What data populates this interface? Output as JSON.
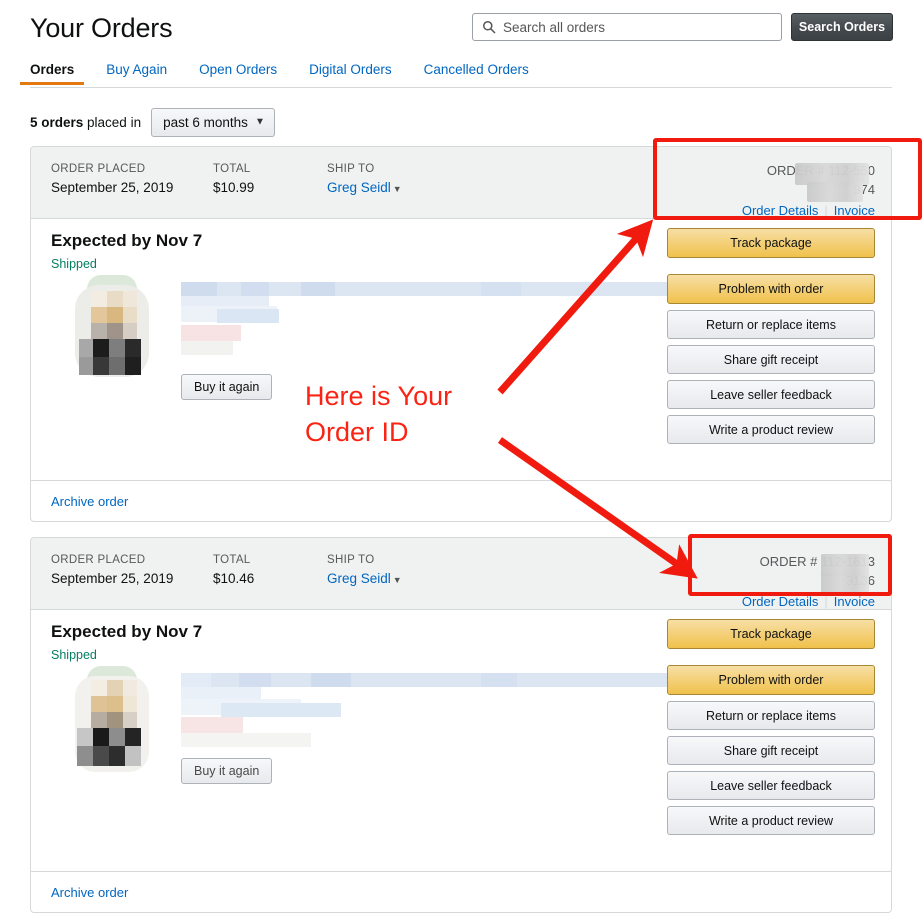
{
  "header": {
    "title": "Your Orders",
    "search": {
      "placeholder": "Search all orders",
      "value": "",
      "icon": "search-icon"
    },
    "search_button": "Search Orders"
  },
  "tabs": [
    {
      "label": "Orders",
      "active": true
    },
    {
      "label": "Buy Again",
      "active": false
    },
    {
      "label": "Open Orders",
      "active": false
    },
    {
      "label": "Digital Orders",
      "active": false
    },
    {
      "label": "Cancelled Orders",
      "active": false
    }
  ],
  "filter": {
    "count_bold": "5 orders",
    "count_rest": " placed in",
    "period_selected": "past 6 months",
    "chevron": "⌵"
  },
  "labels": {
    "order_placed": "ORDER PLACED",
    "total": "TOTAL",
    "ship_to": "SHIP TO",
    "order_details": "Order Details",
    "invoice": "Invoice",
    "archive": "Archive order",
    "buy_again": "Buy it again",
    "order_prefix": "ORDER # "
  },
  "orders": [
    {
      "placed": "September 25, 2019",
      "total": "$10.99",
      "ship_to": "Greg Seidl",
      "order_id_line1": "112-550",
      "order_id_line2": "974",
      "shipment_title": "Expected by Nov 7",
      "status": "Shipped",
      "actions": [
        {
          "label": "Track package",
          "style": "primary"
        },
        {
          "label": "Problem with order",
          "style": "primary2"
        },
        {
          "label": "Return or replace items",
          "style": "secondary"
        },
        {
          "label": "Share gift receipt",
          "style": "secondary"
        },
        {
          "label": "Leave seller feedback",
          "style": "secondary"
        },
        {
          "label": "Write a product review",
          "style": "secondary"
        }
      ]
    },
    {
      "placed": "September 25, 2019",
      "total": "$10.46",
      "ship_to": "Greg Seidl",
      "order_id_line1": "112-1613",
      "order_id_line2": "3136",
      "shipment_title": "Expected by Nov 7",
      "status": "Shipped",
      "actions": [
        {
          "label": "Track package",
          "style": "primary"
        },
        {
          "label": "Problem with order",
          "style": "primary2"
        },
        {
          "label": "Return or replace items",
          "style": "secondary"
        },
        {
          "label": "Share gift receipt",
          "style": "secondary"
        },
        {
          "label": "Leave seller feedback",
          "style": "secondary"
        },
        {
          "label": "Write a product review",
          "style": "secondary"
        }
      ]
    }
  ],
  "annotation": {
    "text": "Here is Your\nOrder ID",
    "color": "#fb2314"
  },
  "colors": {
    "accent_orange": "#e47911",
    "link_blue": "#0066c0",
    "gold_button": "#f0c14b",
    "status_green": "#067d62",
    "annotation_red": "#fb2314",
    "head_gray": "#f0f2f2",
    "border_gray": "#d5d9d9"
  }
}
